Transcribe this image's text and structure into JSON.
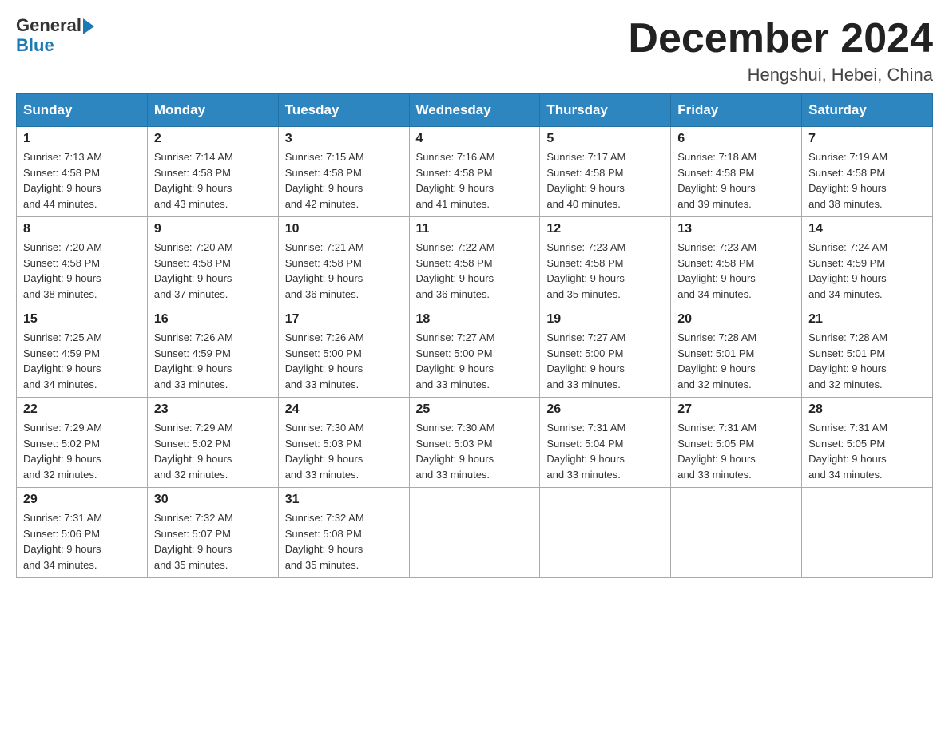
{
  "header": {
    "logo_line1": "General",
    "logo_line2": "Blue",
    "month_title": "December 2024",
    "location": "Hengshui, Hebei, China"
  },
  "days_of_week": [
    "Sunday",
    "Monday",
    "Tuesday",
    "Wednesday",
    "Thursday",
    "Friday",
    "Saturday"
  ],
  "weeks": [
    [
      {
        "day": "1",
        "sunrise": "7:13 AM",
        "sunset": "4:58 PM",
        "daylight": "9 hours and 44 minutes."
      },
      {
        "day": "2",
        "sunrise": "7:14 AM",
        "sunset": "4:58 PM",
        "daylight": "9 hours and 43 minutes."
      },
      {
        "day": "3",
        "sunrise": "7:15 AM",
        "sunset": "4:58 PM",
        "daylight": "9 hours and 42 minutes."
      },
      {
        "day": "4",
        "sunrise": "7:16 AM",
        "sunset": "4:58 PM",
        "daylight": "9 hours and 41 minutes."
      },
      {
        "day": "5",
        "sunrise": "7:17 AM",
        "sunset": "4:58 PM",
        "daylight": "9 hours and 40 minutes."
      },
      {
        "day": "6",
        "sunrise": "7:18 AM",
        "sunset": "4:58 PM",
        "daylight": "9 hours and 39 minutes."
      },
      {
        "day": "7",
        "sunrise": "7:19 AM",
        "sunset": "4:58 PM",
        "daylight": "9 hours and 38 minutes."
      }
    ],
    [
      {
        "day": "8",
        "sunrise": "7:20 AM",
        "sunset": "4:58 PM",
        "daylight": "9 hours and 38 minutes."
      },
      {
        "day": "9",
        "sunrise": "7:20 AM",
        "sunset": "4:58 PM",
        "daylight": "9 hours and 37 minutes."
      },
      {
        "day": "10",
        "sunrise": "7:21 AM",
        "sunset": "4:58 PM",
        "daylight": "9 hours and 36 minutes."
      },
      {
        "day": "11",
        "sunrise": "7:22 AM",
        "sunset": "4:58 PM",
        "daylight": "9 hours and 36 minutes."
      },
      {
        "day": "12",
        "sunrise": "7:23 AM",
        "sunset": "4:58 PM",
        "daylight": "9 hours and 35 minutes."
      },
      {
        "day": "13",
        "sunrise": "7:23 AM",
        "sunset": "4:58 PM",
        "daylight": "9 hours and 34 minutes."
      },
      {
        "day": "14",
        "sunrise": "7:24 AM",
        "sunset": "4:59 PM",
        "daylight": "9 hours and 34 minutes."
      }
    ],
    [
      {
        "day": "15",
        "sunrise": "7:25 AM",
        "sunset": "4:59 PM",
        "daylight": "9 hours and 34 minutes."
      },
      {
        "day": "16",
        "sunrise": "7:26 AM",
        "sunset": "4:59 PM",
        "daylight": "9 hours and 33 minutes."
      },
      {
        "day": "17",
        "sunrise": "7:26 AM",
        "sunset": "5:00 PM",
        "daylight": "9 hours and 33 minutes."
      },
      {
        "day": "18",
        "sunrise": "7:27 AM",
        "sunset": "5:00 PM",
        "daylight": "9 hours and 33 minutes."
      },
      {
        "day": "19",
        "sunrise": "7:27 AM",
        "sunset": "5:00 PM",
        "daylight": "9 hours and 33 minutes."
      },
      {
        "day": "20",
        "sunrise": "7:28 AM",
        "sunset": "5:01 PM",
        "daylight": "9 hours and 32 minutes."
      },
      {
        "day": "21",
        "sunrise": "7:28 AM",
        "sunset": "5:01 PM",
        "daylight": "9 hours and 32 minutes."
      }
    ],
    [
      {
        "day": "22",
        "sunrise": "7:29 AM",
        "sunset": "5:02 PM",
        "daylight": "9 hours and 32 minutes."
      },
      {
        "day": "23",
        "sunrise": "7:29 AM",
        "sunset": "5:02 PM",
        "daylight": "9 hours and 32 minutes."
      },
      {
        "day": "24",
        "sunrise": "7:30 AM",
        "sunset": "5:03 PM",
        "daylight": "9 hours and 33 minutes."
      },
      {
        "day": "25",
        "sunrise": "7:30 AM",
        "sunset": "5:03 PM",
        "daylight": "9 hours and 33 minutes."
      },
      {
        "day": "26",
        "sunrise": "7:31 AM",
        "sunset": "5:04 PM",
        "daylight": "9 hours and 33 minutes."
      },
      {
        "day": "27",
        "sunrise": "7:31 AM",
        "sunset": "5:05 PM",
        "daylight": "9 hours and 33 minutes."
      },
      {
        "day": "28",
        "sunrise": "7:31 AM",
        "sunset": "5:05 PM",
        "daylight": "9 hours and 34 minutes."
      }
    ],
    [
      {
        "day": "29",
        "sunrise": "7:31 AM",
        "sunset": "5:06 PM",
        "daylight": "9 hours and 34 minutes."
      },
      {
        "day": "30",
        "sunrise": "7:32 AM",
        "sunset": "5:07 PM",
        "daylight": "9 hours and 35 minutes."
      },
      {
        "day": "31",
        "sunrise": "7:32 AM",
        "sunset": "5:08 PM",
        "daylight": "9 hours and 35 minutes."
      },
      null,
      null,
      null,
      null
    ]
  ],
  "labels": {
    "sunrise": "Sunrise:",
    "sunset": "Sunset:",
    "daylight": "Daylight:"
  }
}
